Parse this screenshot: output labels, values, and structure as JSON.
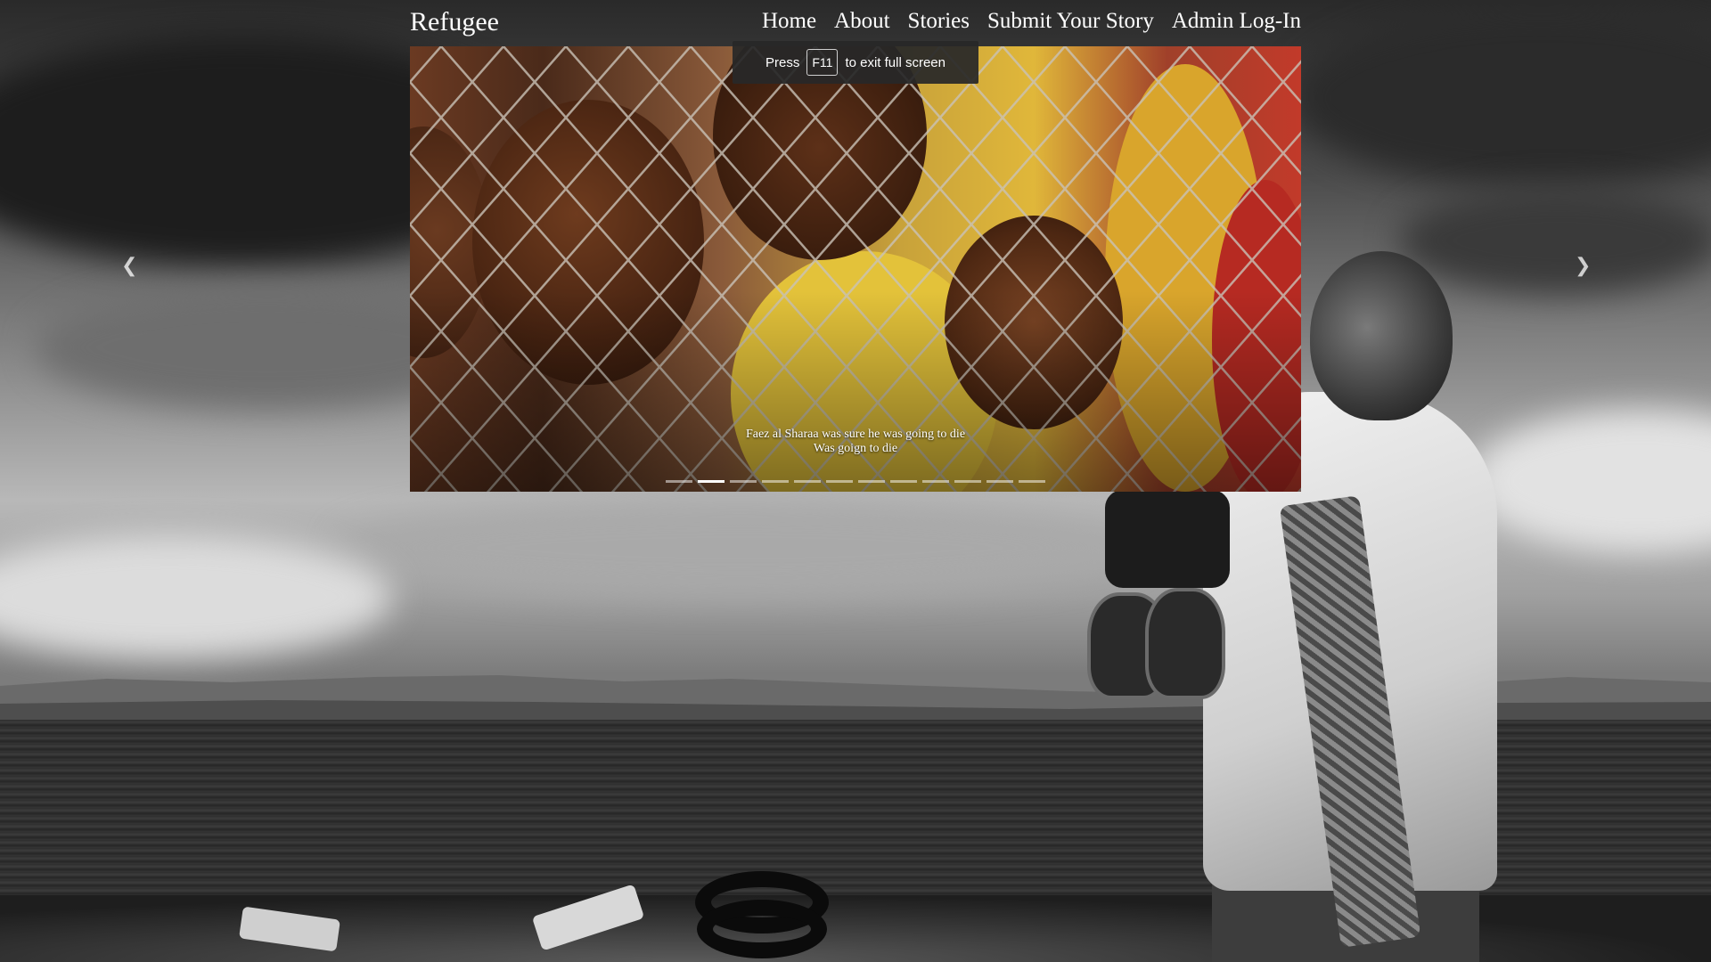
{
  "brand": "Refugee",
  "nav": {
    "home": "Home",
    "about": "About",
    "stories": "Stories",
    "submit": "Submit Your Story",
    "admin": "Admin Log-In"
  },
  "fullscreen_toast": {
    "prefix": "Press",
    "key": "F11",
    "suffix": "to exit full screen"
  },
  "carousel": {
    "caption_line1": "Faez al Sharaa was sure he was going to die",
    "caption_line2": "Was goign to die",
    "slide_count": 12,
    "active_index": 1,
    "prev_icon": "chevron-left-icon",
    "next_icon": "chevron-right-icon"
  }
}
